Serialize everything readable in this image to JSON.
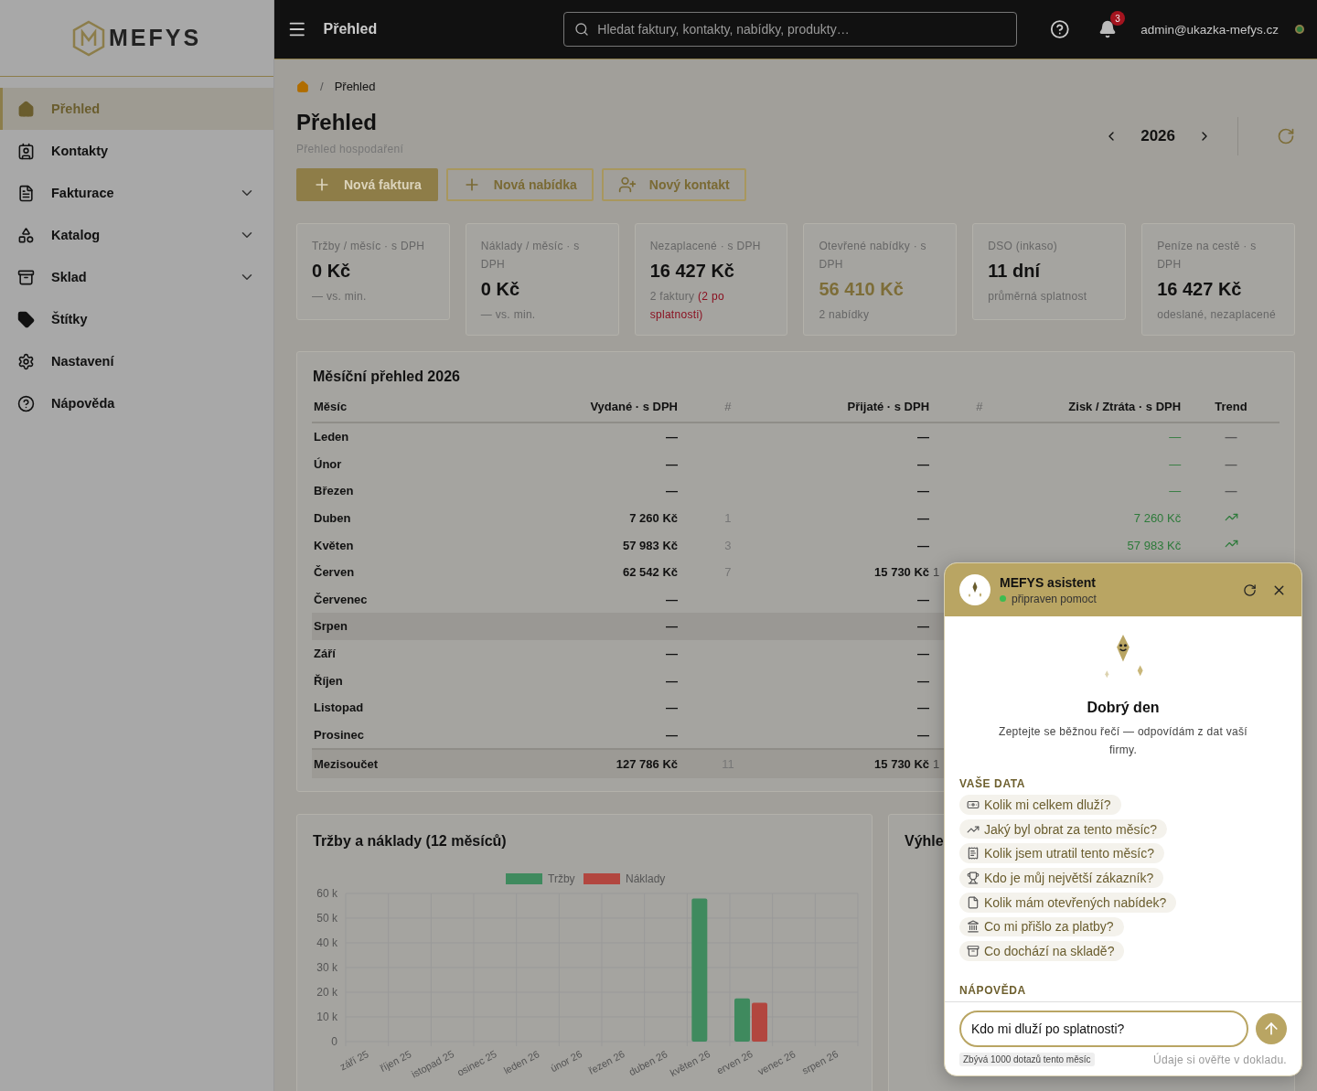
{
  "sidebar": {
    "logo": "MEFYS",
    "items": [
      {
        "label": "Přehled",
        "selected": true
      },
      {
        "label": "Kontakty",
        "selected": false
      },
      {
        "label": "Fakturace",
        "selected": false,
        "expanded": false
      },
      {
        "label": "Katalog",
        "selected": false,
        "expanded": false
      },
      {
        "label": "Sklad",
        "selected": false,
        "expanded": false
      },
      {
        "label": "Štítky",
        "selected": false
      },
      {
        "label": "Nastavení",
        "selected": false
      },
      {
        "label": "Nápověda",
        "selected": false
      }
    ]
  },
  "topbar": {
    "title": "Přehled",
    "search": {
      "placeholder": "Hledat faktury, kontakty, nabídky, produkty…"
    },
    "notifications": "3",
    "user": "admin@ukazka-mefys.cz"
  },
  "breadcrumb": {
    "separator": "/",
    "items": [
      "Přehled"
    ]
  },
  "page": {
    "title": "Přehled",
    "subtitle": "Přehled hospodaření",
    "year": "2026"
  },
  "actions": [
    {
      "label": "Nová faktura",
      "kind": "primary"
    },
    {
      "label": "Nová nabídka",
      "kind": "outline"
    },
    {
      "label": "Nový kontakt",
      "kind": "contact"
    }
  ],
  "kpis": [
    {
      "label": "Tržby / měsíc · s DPH",
      "value": "0 Kč",
      "note": "— vs. min."
    },
    {
      "label": "Náklady / měsíc · s DPH",
      "value": "0 Kč",
      "note": "— vs. min."
    },
    {
      "label": "Nezaplacené · s DPH",
      "value": "16 427 Kč",
      "note": "2 faktury",
      "alert": "(2 po splatnosti)"
    },
    {
      "label": "Otevřené nabídky · s DPH",
      "value": "56 410 Kč",
      "accent": true,
      "note": "2 nabídky"
    },
    {
      "label": "DSO (inkaso)",
      "value": "11 dní",
      "note": "průměrná splatnost"
    },
    {
      "label": "Peníze na cestě · s DPH",
      "value": "16 427 Kč",
      "note": "odeslané, nezaplacené"
    }
  ],
  "monthly": {
    "title": "Měsíční přehled 2026",
    "columns": [
      "Měsíc",
      "Vydané · s DPH",
      "#",
      "Přijaté · s DPH",
      "#",
      "Zisk / Ztráta · s DPH",
      "Trend"
    ],
    "rows": [
      {
        "month": "Leden",
        "issued": "—",
        "received": "—",
        "profit": "—",
        "trend": "—",
        "hovered": false
      },
      {
        "month": "Únor",
        "issued": "—",
        "received": "—",
        "profit": "—",
        "trend": "—",
        "hovered": false
      },
      {
        "month": "Březen",
        "issued": "—",
        "received": "—",
        "profit": "—",
        "trend": "—",
        "hovered": false
      },
      {
        "month": "Duben",
        "issued": "7 260 Kč",
        "issued_count": "1",
        "received": "—",
        "profit": "7 260 Kč",
        "trend_up": true,
        "hovered": false
      },
      {
        "month": "Květen",
        "issued": "57 983 Kč",
        "issued_count": "3",
        "received": "—",
        "profit": "57 983 Kč",
        "trend_up": true,
        "hovered": false
      },
      {
        "month": "Červen",
        "issued": "62 542 Kč",
        "issued_count": "7",
        "received": "15 730 Kč",
        "received_count": "1",
        "hovered": false
      },
      {
        "month": "Červenec",
        "issued": "—",
        "received": "—",
        "hovered": false
      },
      {
        "month": "Srpen",
        "issued": "—",
        "received": "—",
        "hovered": true
      },
      {
        "month": "Září",
        "issued": "—",
        "received": "—",
        "hovered": false
      },
      {
        "month": "Říjen",
        "issued": "—",
        "received": "—",
        "hovered": false
      },
      {
        "month": "Listopad",
        "issued": "—",
        "received": "—",
        "hovered": false
      },
      {
        "month": "Prosinec",
        "issued": "—",
        "received": "—",
        "hovered": false
      }
    ],
    "total": {
      "month": "Mezisoučet",
      "issued": "127 786 Kč",
      "issued_count": "11",
      "received": "15 730 Kč",
      "received_count": "1"
    }
  },
  "revenue_chart": {
    "title": "Tržby a náklady (12 měsíců)",
    "chart_data": {
      "type": "bar",
      "categories": [
        "září 25",
        "říjen 25",
        "istopad 25",
        "osinec 25",
        "leden 26",
        "únor 26",
        "řezen 26",
        "duben 26",
        "květen 26",
        "erven 26",
        "venec 26",
        "srpen 26"
      ],
      "series": [
        {
          "name": "Tržby",
          "color": "#3f8a5e",
          "values": [
            0,
            0,
            0,
            0,
            0,
            0,
            0,
            0,
            58000,
            17500,
            0,
            0
          ]
        },
        {
          "name": "Náklady",
          "color": "#b2463f",
          "values": [
            0,
            0,
            0,
            0,
            0,
            0,
            0,
            0,
            0,
            15700,
            0,
            0
          ]
        }
      ],
      "grid": true,
      "legend": true,
      "ylim": [
        0,
        60000
      ],
      "yticks": [
        {
          "value": 0,
          "label": "0"
        },
        {
          "value": 10000,
          "label": "10 k"
        },
        {
          "value": 20000,
          "label": "20 k"
        },
        {
          "value": 30000,
          "label": "30 k"
        },
        {
          "value": 40000,
          "label": "40 k"
        },
        {
          "value": 50000,
          "label": "50 k"
        },
        {
          "value": 60000,
          "label": "60 k"
        }
      ]
    }
  },
  "outlook": {
    "title": "Výhle"
  },
  "assistant": {
    "title": "MEFYS asistent",
    "status": "připraven pomoct",
    "online": true,
    "greeting": "Dobrý den",
    "intro": "Zeptejte se běžnou řečí — odpovídám z dat vaší firmy.",
    "sections": [
      {
        "label": "VAŠE DATA",
        "suggestions": [
          "Kolik mi celkem dluží?",
          "Jaký byl obrat za tento měsíc?",
          "Kolik jsem utratil tento měsíc?",
          "Kdo je můj největší zákazník?",
          "Kolik mám otevřených nabídek?",
          "Co mi přišlo za platby?",
          "Co dochází na skladě?"
        ]
      },
      {
        "label": "NÁPOVĚDA"
      }
    ],
    "input": {
      "value": "Kdo mi dluží po splatnosti?"
    },
    "quota": "Zbývá 1000 dotazů tento měsíc",
    "disclaimer": "Údaje si ověřte v dokladu."
  }
}
